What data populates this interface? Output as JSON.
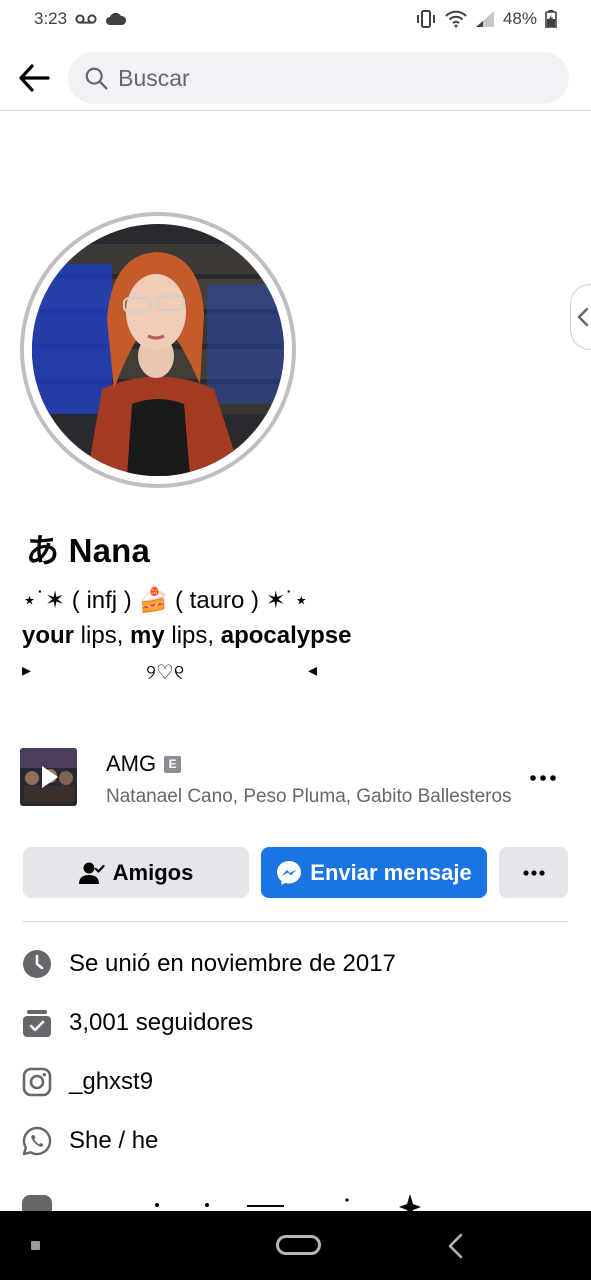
{
  "status_bar": {
    "time": "3:23",
    "battery": "48%"
  },
  "search": {
    "placeholder": "Buscar"
  },
  "profile": {
    "name": "あ Nana",
    "bio_line1": "⋆˙✶ ( infj ) 🍰 ( tauro ) ✶˙⋆",
    "bio_line2": [
      {
        "text": "your",
        "bold": true
      },
      {
        "text": " lips, ",
        "bold": false
      },
      {
        "text": "my",
        "bold": true
      },
      {
        "text": " lips, ",
        "bold": false
      },
      {
        "text": "apocalypse",
        "bold": true
      }
    ],
    "bio_line3_left": "▸",
    "bio_line3_center": "୨♡୧",
    "bio_line3_right": "◂"
  },
  "music": {
    "title": "AMG",
    "explicit_badge": "E",
    "artists": "Natanael Cano, Peso Pluma, Gabito Ballesteros"
  },
  "actions": {
    "friends_label": "Amigos",
    "message_label": "Enviar mensaje"
  },
  "details": [
    {
      "icon": "clock-icon",
      "text": "Se unió en noviembre de 2017"
    },
    {
      "icon": "followers-icon",
      "text": "3,001 seguidores"
    },
    {
      "icon": "instagram-icon",
      "text": "_ghxst9"
    },
    {
      "icon": "whatsapp-icon",
      "text": "She / he"
    }
  ],
  "colors": {
    "accent": "#1b74e4",
    "secondary_button": "#e4e6eb",
    "search_bg": "#f0f2f5",
    "muted_text": "#65676b",
    "icon_gray": "#65676b"
  }
}
